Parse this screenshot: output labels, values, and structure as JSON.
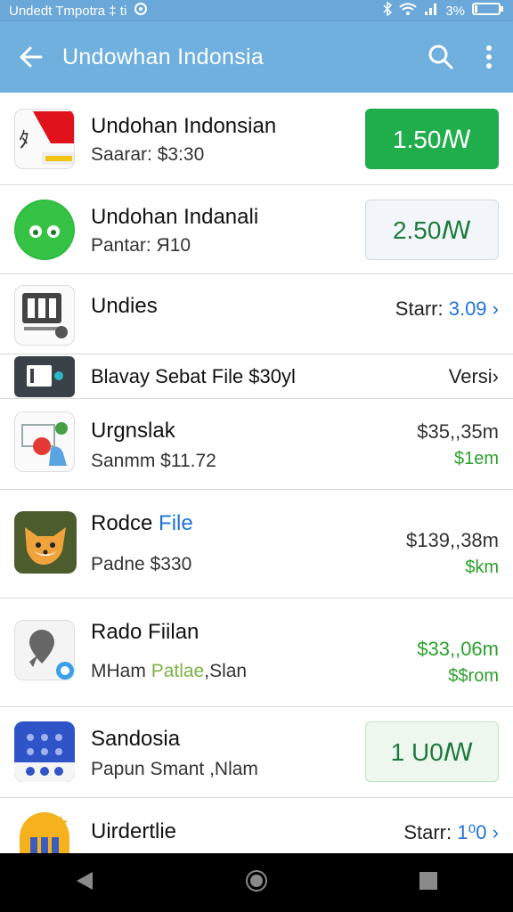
{
  "status_bar": {
    "left_text": "Undedt Tmpotra ‡ ti",
    "battery": "3%"
  },
  "app_bar": {
    "title": "Undowhan Indonsia"
  },
  "items": [
    {
      "name": "Undohan Indonsian",
      "sub": "Saarar: $3:30",
      "action": "1.50ꟿ",
      "action_style": "green"
    },
    {
      "name": "Undohan Indanali",
      "sub": "Pantar: Я10",
      "action": "2.50ꟿ",
      "action_style": "outline"
    },
    {
      "name": "Undies",
      "right_label": "Starr:",
      "right_value": "3.09"
    },
    {
      "name": "Blavay Sebat File $30yl",
      "right_label": "Versi"
    },
    {
      "name": "Urgnslak",
      "sub": "Sanmm $11.72",
      "price": "$35,,35m",
      "price2": "$1em"
    },
    {
      "name_a": "Rodce",
      "name_b": "File",
      "sub": "Padne $330",
      "price": "$139,,38m",
      "price2": "$km"
    },
    {
      "name": "Rado Fiilan",
      "sub_a": "MHam",
      "sub_b": "Patlae",
      "sub_c": ",Slan",
      "price": "$33,,06m",
      "price2": "$$rom"
    },
    {
      "name": "Sandosia",
      "sub": "Papun Smant ,Nlam",
      "action": "1 U0ꟿ",
      "action_style": "outline2"
    },
    {
      "name": "Uirdertlie",
      "right_label": "Starr:",
      "right_value": "1⁰0"
    }
  ],
  "colors": {
    "app_bar": "#6fb0df",
    "green": "#1fae4b",
    "link_blue": "#1e73d8",
    "price_green": "#2ca02c"
  }
}
